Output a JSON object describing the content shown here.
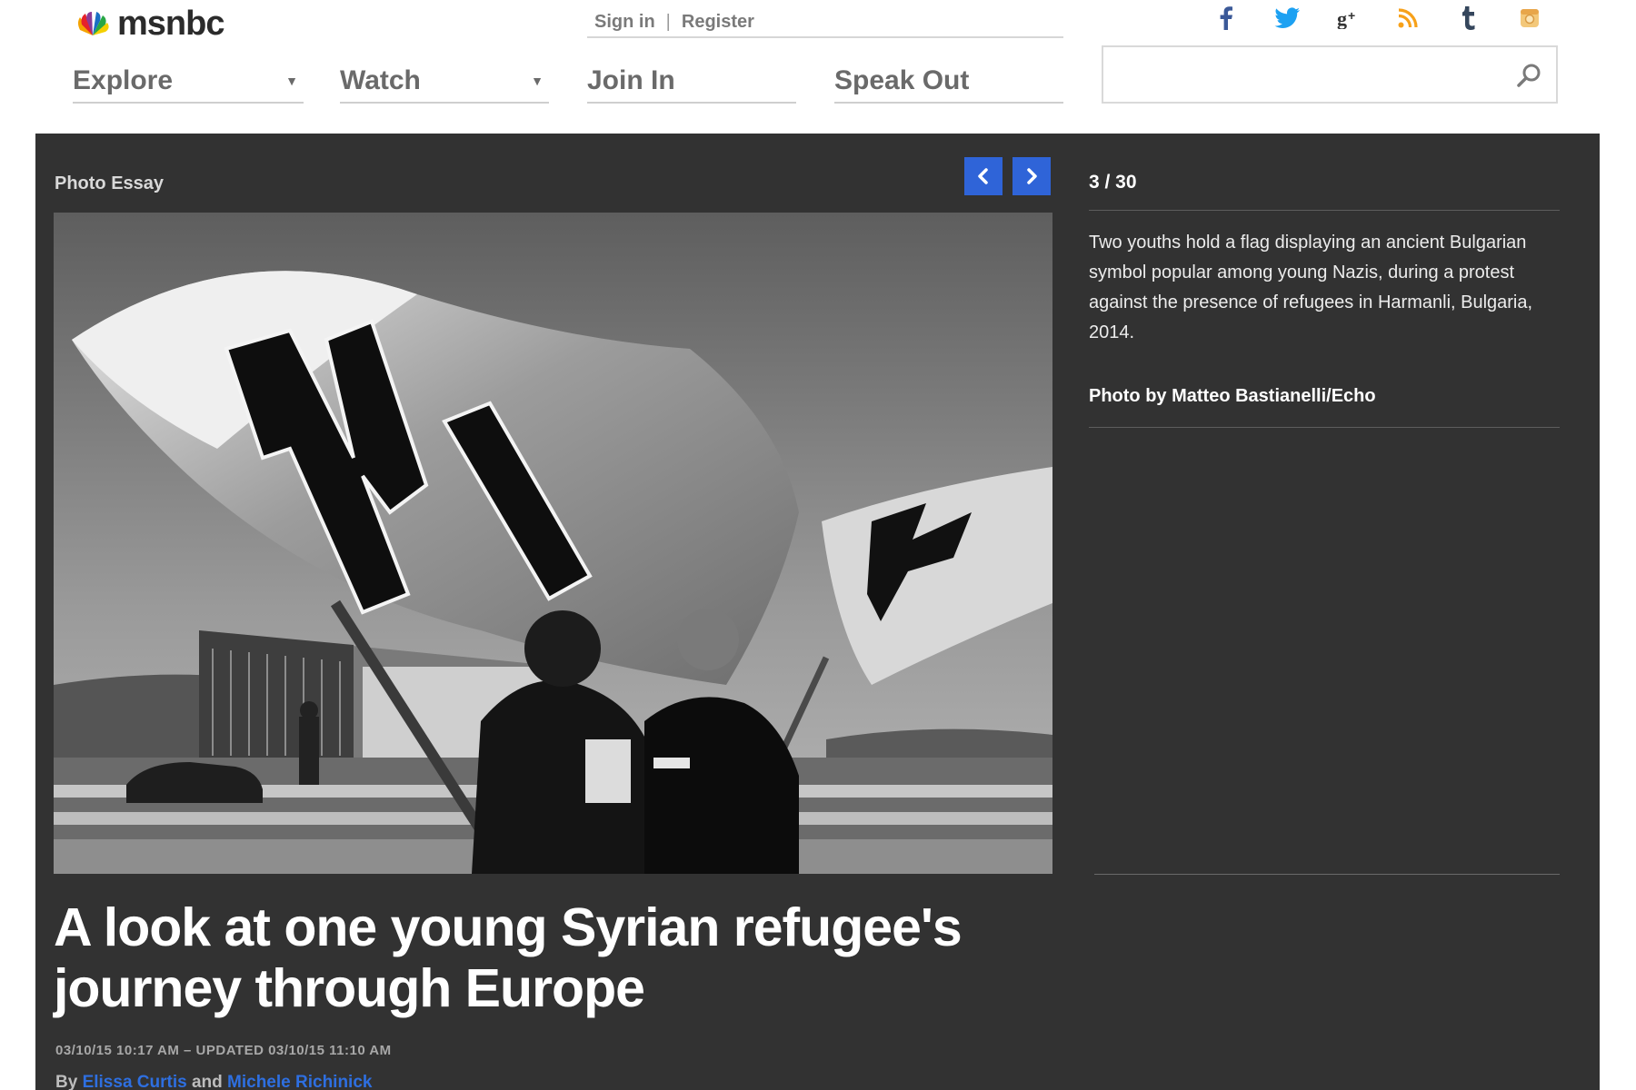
{
  "brand": {
    "name": "msnbc"
  },
  "auth": {
    "sign_in": "Sign in",
    "separator": "|",
    "register": "Register"
  },
  "nav": {
    "explore": "Explore",
    "watch": "Watch",
    "join_in": "Join In",
    "speak_out": "Speak Out"
  },
  "social": [
    "facebook-icon",
    "twitter-icon",
    "google-plus-icon",
    "rss-icon",
    "tumblr-icon",
    "instagram-icon"
  ],
  "search": {
    "placeholder": ""
  },
  "gallery": {
    "section_label": "Photo Essay",
    "counter": "3 / 30",
    "caption": "Two youths hold a flag displaying an ancient Bulgarian symbol popular among young Nazis, during a protest against the presence of refugees in Harmanli, Bulgaria, 2014.",
    "credit": "Photo by Matteo Bastianelli/Echo"
  },
  "article": {
    "headline": "A look at one young Syrian refugee's journey through Europe",
    "timestamp": "03/10/15 10:17 AM – UPDATED 03/10/15 11:10 AM",
    "by": "By",
    "author1": "Elissa Curtis",
    "and": "and",
    "author2": "Michele Richinick"
  },
  "colors": {
    "accent_blue": "#2f64d8",
    "facebook": "#3b5998",
    "twitter": "#1da1f2",
    "rss": "#f7a11a",
    "tumblr": "#35465c",
    "instagram": "#f0c070",
    "panel_bg": "#323232"
  }
}
